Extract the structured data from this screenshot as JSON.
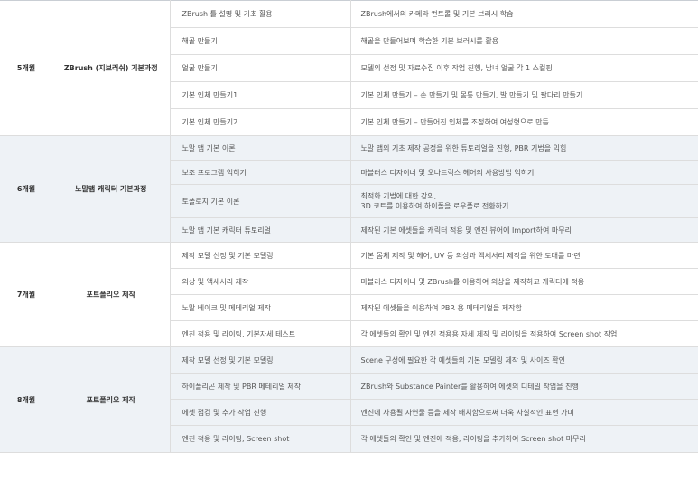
{
  "groups": [
    {
      "month": "5개월",
      "course": "ZBrush (지브러쉬) 기본과정",
      "shaded": false,
      "rows": [
        {
          "topic": "ZBrush 툴 설명 및 기초 활용",
          "desc": [
            "ZBrush에서의 카메라 컨트롤 및 기본 브러시 학습"
          ]
        },
        {
          "topic": "해골 만들기",
          "desc": [
            "해골을 만들어보며 학습한 기본 브러시를 활용"
          ]
        },
        {
          "topic": "얼굴 만들기",
          "desc": [
            "모델의 선정 및 자료수집 이후 작업 진행, 남녀 얼굴 각 1 스컬핑"
          ]
        },
        {
          "topic": "기본 인체 만들기1",
          "desc": [
            "기본 인체 만들기 – 손 만들기 및 몸통 만들기, 발 만들기 및 팔다리 만들기"
          ]
        },
        {
          "topic": "기본 인체 만들기2",
          "desc": [
            "기본 인체 만들기 – 만들어진 인체를 조정하여 여성형으로 만듬"
          ]
        }
      ]
    },
    {
      "month": "6개월",
      "course": "노말맵 캐릭터 기본과정",
      "shaded": true,
      "rows": [
        {
          "topic": "노말 맵 기본 이론",
          "desc": [
            "노말 맵의 기초 제작 공정을 위한 튜토리얼을 진행, PBR 기법을 익힘"
          ]
        },
        {
          "topic": "보조 프로그램 익히기",
          "desc": [
            "마블러스 디자이너 및 오나트릭스 헤어의 사용방법 익히기"
          ]
        },
        {
          "topic": "토폴로지 기본 이론",
          "desc": [
            "최적화 기법에 대한 강의,",
            "3D 코트를 이용하여 하이폴을 로우폴로 전환하기"
          ]
        },
        {
          "topic": "노말 맵 기본 캐릭터 튜토리얼",
          "desc": [
            "제작된 기본 에셋들을 캐릭터 적용 및 엔진 뷰어에 Import하여 마무리"
          ]
        }
      ]
    },
    {
      "month": "7개월",
      "course": "포트폴리오 제작",
      "shaded": false,
      "rows": [
        {
          "topic": "제작 모델 선정 및 기본 모델링",
          "desc": [
            "기본 몸체 제작 및 헤어, UV 등 의상과 액세서리 제작을 위한 토대를 마련"
          ]
        },
        {
          "topic": "의상 및 액세서리 제작",
          "desc": [
            "마블러스 디자이너 및 ZBrush를 이용하여 의상을 제작하고 캐릭터에 적용"
          ]
        },
        {
          "topic": "노말 베이크 및 메테리얼 제작",
          "desc": [
            "제작된 에셋들을 이용하여 PBR 용 메테리얼을 제작함"
          ]
        },
        {
          "topic": "엔진 적용 및 라이팅, 기본자세 테스트",
          "desc": [
            "각 에셋들의 확인 및 엔진 적용용 자세 제작 및 라이팅을 적용하여 Screen shot 작업"
          ]
        }
      ]
    },
    {
      "month": "8개월",
      "course": "포트폴리오 제작",
      "shaded": true,
      "rows": [
        {
          "topic": "제작 모델 선정 및 기본 모델링",
          "desc": [
            "Scene 구성에 필요한 각 에셋들의 기본 모델링 제작 및 사이즈 확인"
          ]
        },
        {
          "topic": "하이폴리곤 제작 및 PBR 메테리얼 제작",
          "desc": [
            "ZBrush와 Substance Painter를 활용하여 에셋의 디테일 작업을 진행"
          ]
        },
        {
          "topic": "에셋 점검 및 추가 작업 진행",
          "desc": [
            "엔진에 사용될 자연물 등을 제작 배치함으로써 더욱 사실적인 표현 가미"
          ]
        },
        {
          "topic": "엔진 적용 및 라이팅, Screen shot",
          "desc": [
            "각 에셋들의 확인 및 엔진에 적용, 라이팅을 추가하여 Screen shot 마무리"
          ]
        }
      ]
    }
  ]
}
